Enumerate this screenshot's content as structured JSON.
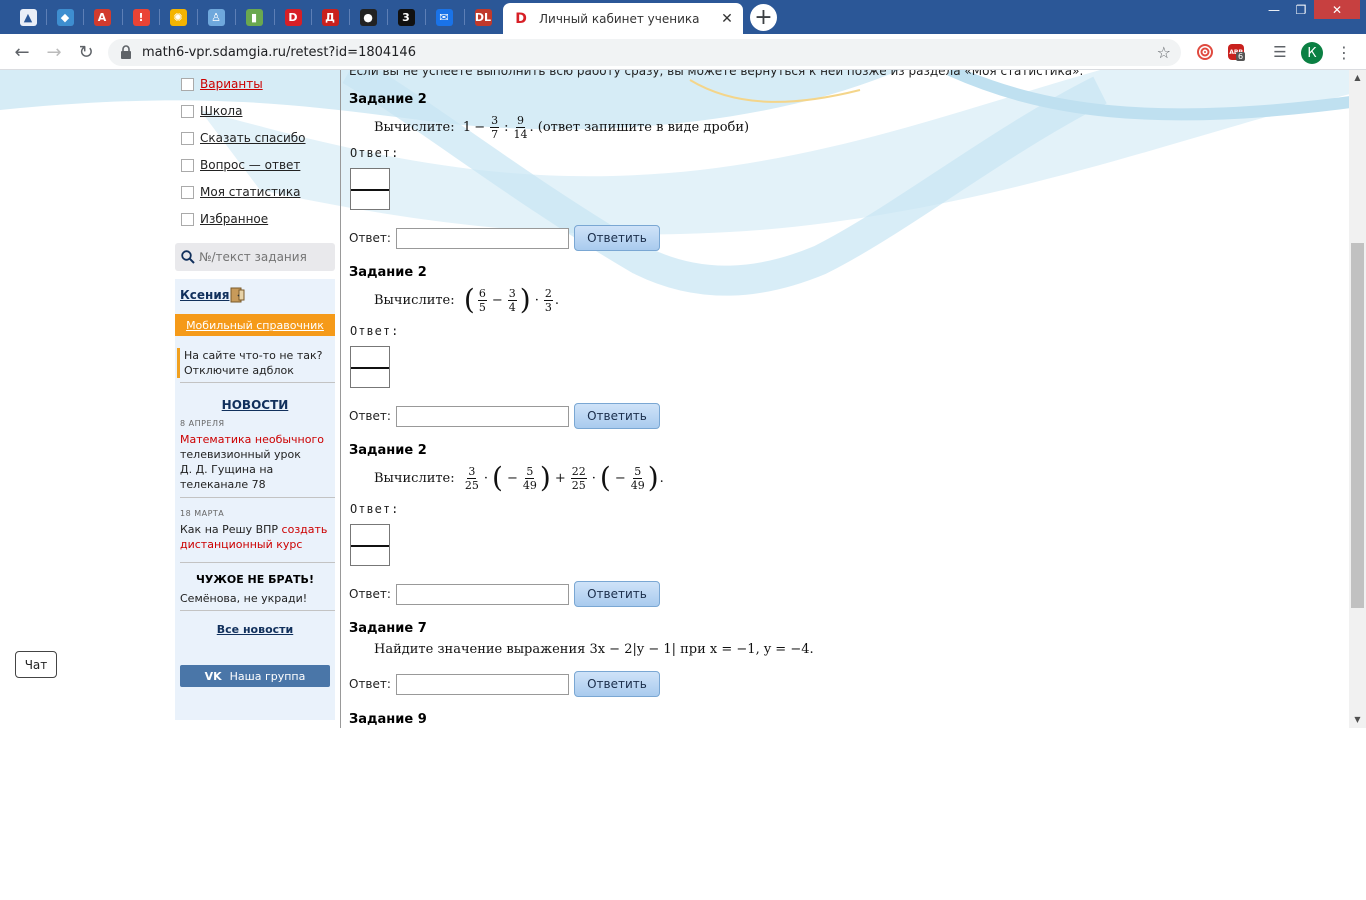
{
  "browser": {
    "pinned_tabs": [
      {
        "icon": "vpr-triangle-icon",
        "color": "#e9eef7"
      },
      {
        "icon": "shield-icon",
        "color": "#3e8ed0"
      },
      {
        "icon": "a5-icon",
        "color": "#d23b2e"
      },
      {
        "icon": "alert-icon",
        "color": "#ea4335"
      },
      {
        "icon": "wheel-icon",
        "color": "#f4b400"
      },
      {
        "icon": "person-icon",
        "color": "#6fa8dc"
      },
      {
        "icon": "book-icon",
        "color": "#6aa84f"
      },
      {
        "icon": "d-logo-icon",
        "color": "#d71f26"
      },
      {
        "icon": "d-letter-icon",
        "color": "#c9211e"
      },
      {
        "icon": "panda-icon",
        "color": "#222222"
      },
      {
        "icon": "three-icon",
        "color": "#111111"
      },
      {
        "icon": "mail-icon",
        "color": "#1a73e8"
      },
      {
        "icon": "dl-icon",
        "color": "#c0392b"
      }
    ],
    "active_tab": {
      "title": "Личный кабинет ученика",
      "icon": "reshu-d-icon",
      "close": "✕"
    },
    "new_tab": "+",
    "window_controls": {
      "minimize": "—",
      "maximize": "❐",
      "close": "✕"
    },
    "url": "math6-vpr.sdamgia.ru/retest?id=1804146",
    "extensions": {
      "abp_badge": "6",
      "avatar_letter": "К"
    }
  },
  "sidebar": {
    "menu": [
      {
        "label": "Варианты",
        "red": true
      },
      {
        "label": "Школа",
        "red": false
      },
      {
        "label": "Сказать спасибо",
        "red": false
      },
      {
        "label": "Вопрос — ответ",
        "red": false
      },
      {
        "label": "Моя статистика",
        "red": false
      },
      {
        "label": "Избранное",
        "red": false
      }
    ],
    "search": {
      "placeholder": "№/текст задания"
    },
    "user_name": "Ксения",
    "mobile_ref": "Мобильный справочник",
    "adblock": {
      "line1": "На сайте что-то не так?",
      "line2": "Отключите адблок"
    },
    "news": {
      "title": "НОВОСТИ",
      "items": [
        {
          "date": "8 АПРЕЛЯ",
          "red": "Математика необычного",
          "text": "телевизионный урок\nД. Д. Гущина на\nтелеканале 78"
        },
        {
          "date": "18 МАРТА",
          "text": "Как на Решу ВПР ",
          "red": "создать\nдистанционный курс"
        }
      ],
      "alien_title": "ЧУЖОЕ НЕ БРАТЬ!",
      "alien_text": "Семёнова, не укради!",
      "all_news": "Все новости"
    },
    "vk_label": "Наша группа",
    "vk_logo": "VK"
  },
  "chat_label": "Чат",
  "main": {
    "intro": "Если вы не успеете выполнить всю работу сразу, вы можете вернуться к ней позже из раздела «Моя статистика».",
    "answer_word": "Ответ:",
    "answer_btn": "Ответить",
    "tasks": [
      {
        "title": "Задание 2",
        "lead": "Вычислите:",
        "expr": {
          "whole": "1",
          "op1": "−",
          "f1n": "3",
          "f1d": "7",
          "op2": ":",
          "f2n": "9",
          "f2d": "14"
        },
        "tail": ". (ответ запишите в виде дроби)"
      },
      {
        "title": "Задание 2",
        "lead": "Вычислите:",
        "expr": {
          "lp": "(",
          "f1n": "6",
          "f1d": "5",
          "op1": "−",
          "f2n": "3",
          "f2d": "4",
          "rp": ")",
          "op2": "·",
          "f3n": "2",
          "f3d": "3"
        },
        "tail": "."
      },
      {
        "title": "Задание 2",
        "lead": "Вычислите:",
        "expr": {
          "f1n": "3",
          "f1d": "25",
          "dot1": "·",
          "lp1": "(",
          "m1": "−",
          "f2n": "5",
          "f2d": "49",
          "rp1": ")",
          "plus": "+",
          "f3n": "22",
          "f3d": "25",
          "dot2": "·",
          "lp2": "(",
          "m2": "−",
          "f4n": "5",
          "f4d": "49",
          "rp2": ")"
        },
        "tail": "."
      },
      {
        "title": "Задание 7",
        "text": "Найдите значение выражения  3x − 2|y − 1|  при  x = −1,  y = −4."
      },
      {
        "title": "Задание 9"
      }
    ]
  },
  "colors": {
    "tabstrip": "#2b5797",
    "button": "#a9cbee",
    "orange": "#f59a19",
    "vk": "#4a76a8",
    "link_red": "#cc0000"
  }
}
